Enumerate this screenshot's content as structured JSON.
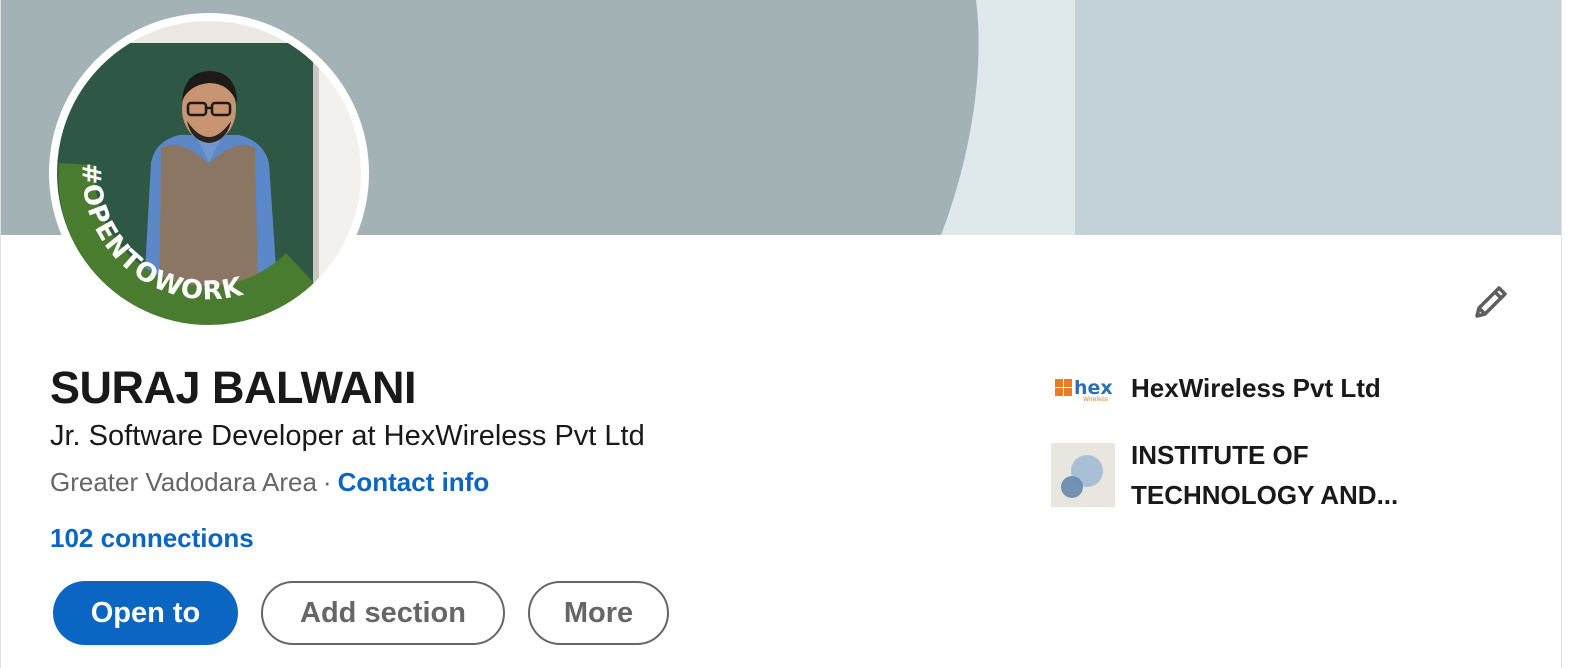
{
  "profile": {
    "name": "SURAJ BALWANI",
    "headline": "Jr. Software Developer at HexWireless Pvt Ltd",
    "location": "Greater Vadodara Area",
    "separator": "·",
    "contact_info_label": "Contact info",
    "connections_label": "102 connections",
    "open_to_work_frame": "#OPENTOWORK"
  },
  "actions": {
    "open_to_label": "Open to",
    "add_section_label": "Add section",
    "more_label": "More"
  },
  "experience_summary": {
    "company": {
      "name": "HexWireless Pvt Ltd",
      "logo_text": "hex",
      "logo_subtext": "Wireless",
      "icon": "hexwireless-logo"
    },
    "school": {
      "name": "INSTITUTE OF TECHNOLOGY AND...",
      "icon": "school-placeholder-logo"
    }
  },
  "icons": {
    "edit": "pencil-icon"
  },
  "colors": {
    "link_blue": "#0a66c2",
    "banner_dark": "#a3b2b5",
    "banner_light": "#c2d2d6",
    "open_to_work_green": "#4a7c2f",
    "text_primary": "#191919",
    "text_secondary": "#666666"
  }
}
